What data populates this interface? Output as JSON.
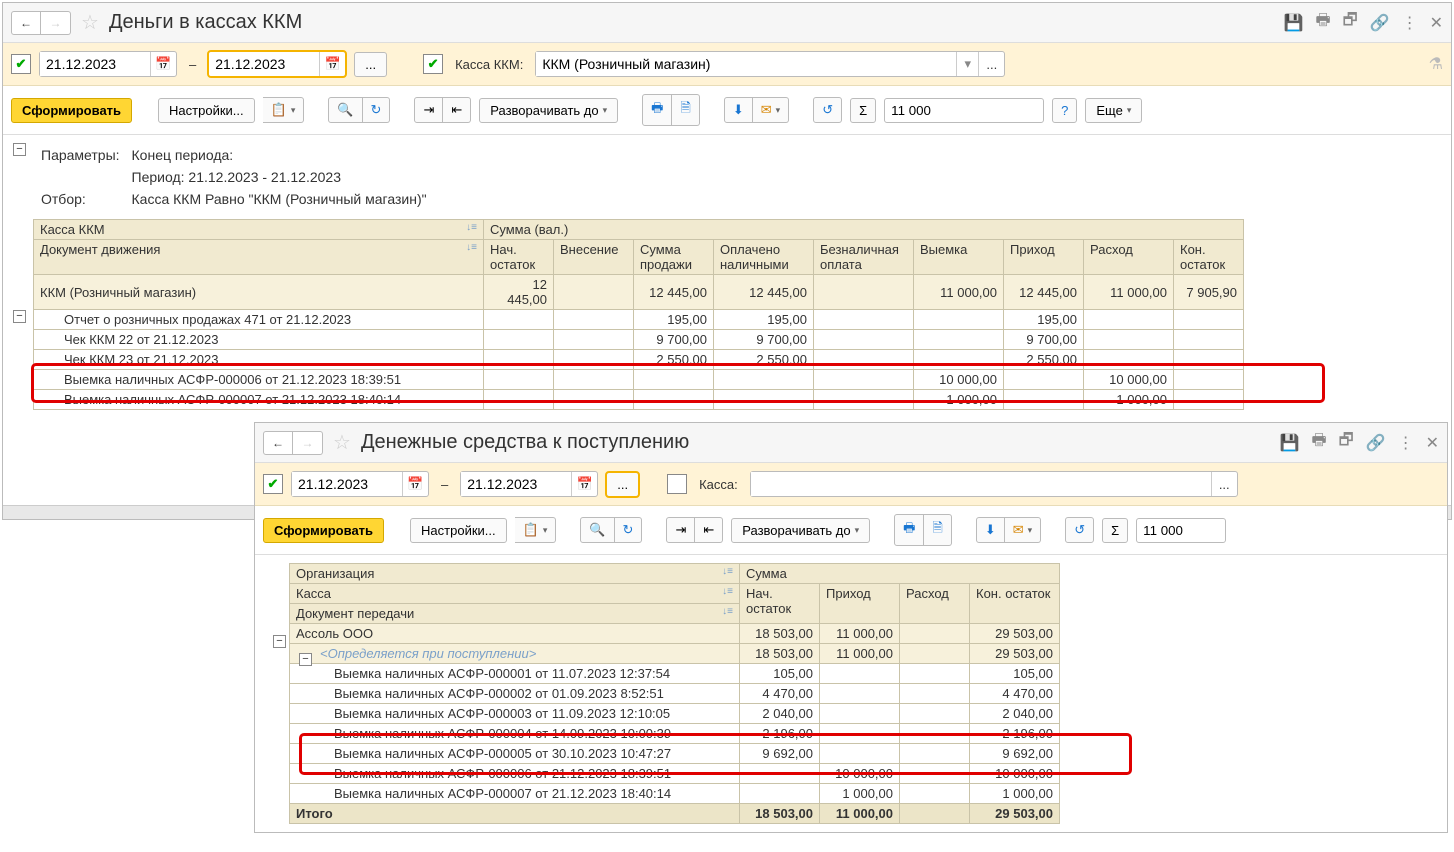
{
  "win1": {
    "title": "Деньги в кассах ККМ",
    "date_from": "21.12.2023",
    "date_to": "21.12.2023",
    "kassa_label": "Касса ККМ:",
    "kassa_value": "ККМ (Розничный магазин)",
    "generate": "Сформировать",
    "settings": "Настройки...",
    "expand": "Разворачивать до",
    "search_value": "11 000",
    "more": "Еще",
    "params": {
      "p_label": "Параметры:",
      "end": "Конец периода:",
      "period": "Период: 21.12.2023 - 21.12.2023",
      "filter_label": "Отбор:",
      "filter": "Касса ККМ Равно \"ККМ (Розничный магазин)\""
    },
    "headers": {
      "kassa": "Касса ККМ",
      "doc": "Документ движения",
      "summa": "Сумма (вал.)",
      "c1": "Нач. остаток",
      "c2": "Внесение",
      "c3": "Сумма продажи",
      "c4": "Оплачено наличными",
      "c5": "Безналичная оплата",
      "c6": "Выемка",
      "c7": "Приход",
      "c8": "Расход",
      "c9": "Кон. остаток"
    },
    "rows": [
      {
        "type": "group",
        "doc": "ККМ (Розничный магазин)",
        "c1": "12 445,00",
        "c3": "12 445,00",
        "c4": "12 445,00",
        "c6": "11 000,00",
        "c7": "12 445,00",
        "c8": "11 000,00",
        "c9": "7 905,90"
      },
      {
        "type": "d",
        "doc": "Отчет о розничных продажах 471 от 21.12.2023",
        "c3": "195,00",
        "c4": "195,00",
        "c7": "195,00"
      },
      {
        "type": "d",
        "doc": "Чек ККМ 22 от 21.12.2023",
        "c3": "9 700,00",
        "c4": "9 700,00",
        "c7": "9 700,00"
      },
      {
        "type": "d",
        "doc": "Чек ККМ 23 от 21.12.2023",
        "c3": "2 550,00",
        "c4": "2 550,00",
        "c7": "2 550,00"
      },
      {
        "type": "d",
        "doc": "Выемка наличных АСФР-000006 от 21.12.2023 18:39:51",
        "c6": "10 000,00",
        "c8": "10 000,00"
      },
      {
        "type": "d",
        "doc": "Выемка наличных АСФР-000007 от 21.12.2023 18:40:14",
        "c6": "1 000,00",
        "c8": "1 000,00"
      }
    ]
  },
  "win2": {
    "title": "Денежные средства к поступлению",
    "date_from": "21.12.2023",
    "date_to": "21.12.2023",
    "kassa_label": "Касса:",
    "generate": "Сформировать",
    "settings": "Настройки...",
    "expand": "Разворачивать до",
    "search_value": "11 000",
    "headers": {
      "org": "Организация",
      "kassa": "Касса",
      "doc": "Документ передачи",
      "summa": "Сумма",
      "c1": "Нач. остаток",
      "c2": "Приход",
      "c3": "Расход",
      "c4": "Кон. остаток"
    },
    "rows": [
      {
        "type": "g1",
        "doc": "Ассоль ООО",
        "c1": "18 503,00",
        "c2": "11 000,00",
        "c4": "29 503,00"
      },
      {
        "type": "g2",
        "doc": "<Определяется при поступлении>",
        "italic": true,
        "c1": "18 503,00",
        "c2": "11 000,00",
        "c4": "29 503,00"
      },
      {
        "type": "d",
        "doc": "Выемка наличных АСФР-000001 от 11.07.2023 12:37:54",
        "c1": "105,00",
        "c4": "105,00"
      },
      {
        "type": "d",
        "doc": "Выемка наличных АСФР-000002 от 01.09.2023 8:52:51",
        "c1": "4 470,00",
        "c4": "4 470,00"
      },
      {
        "type": "d",
        "doc": "Выемка наличных АСФР-000003 от 11.09.2023 12:10:05",
        "c1": "2 040,00",
        "c4": "2 040,00"
      },
      {
        "type": "d",
        "doc": "Выемка наличных АСФР-000004 от 14.09.2023 10:00:39",
        "c1": "2 196,00",
        "c4": "2 196,00"
      },
      {
        "type": "d",
        "doc": "Выемка наличных АСФР-000005 от 30.10.2023 10:47:27",
        "c1": "9 692,00",
        "c4": "9 692,00"
      },
      {
        "type": "d",
        "doc": "Выемка наличных АСФР-000006 от 21.12.2023 18:39:51",
        "c2": "10 000,00",
        "c4": "10 000,00"
      },
      {
        "type": "d",
        "doc": "Выемка наличных АСФР-000007 от 21.12.2023 18:40:14",
        "c2": "1 000,00",
        "c4": "1 000,00"
      },
      {
        "type": "total",
        "doc": "Итого",
        "c1": "18 503,00",
        "c2": "11 000,00",
        "c4": "29 503,00"
      }
    ]
  }
}
